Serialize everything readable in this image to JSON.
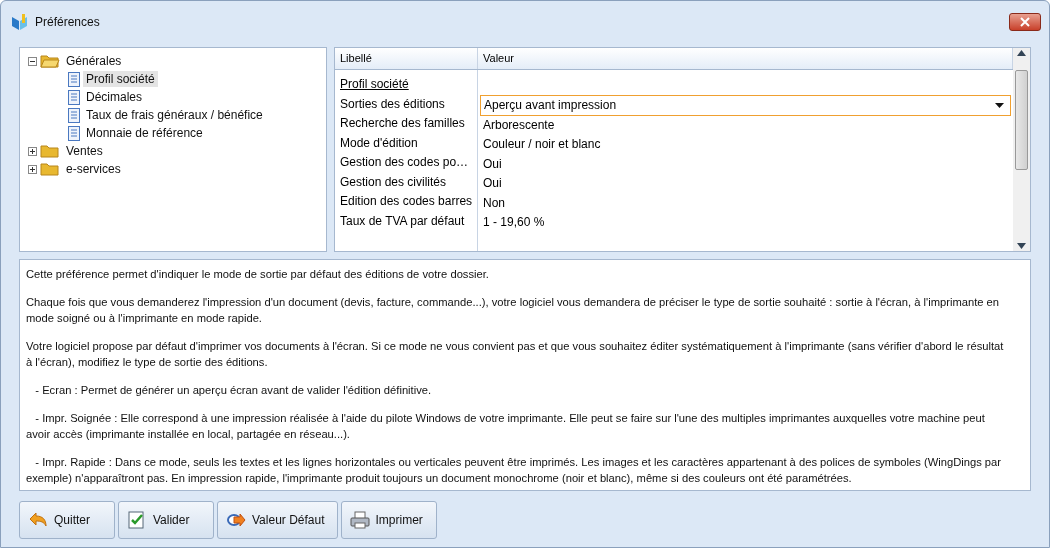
{
  "window": {
    "title": "Préférences"
  },
  "tree": [
    {
      "label": "Générales",
      "expanded": true,
      "selected": false,
      "children": [
        {
          "label": "Profil société",
          "selected": true
        },
        {
          "label": "Décimales",
          "selected": false
        },
        {
          "label": "Taux de frais généraux / bénéfice",
          "selected": false
        },
        {
          "label": "Monnaie de référence",
          "selected": false
        }
      ]
    },
    {
      "label": "Ventes",
      "expanded": false,
      "selected": false
    },
    {
      "label": "e-services",
      "expanded": false,
      "selected": false
    }
  ],
  "grid": {
    "columns": [
      "Libellé",
      "Valeur"
    ],
    "rows": [
      {
        "kind": "section",
        "label": "Profil société"
      },
      {
        "kind": "combo",
        "label": "Sorties des éditions",
        "value": "Aperçu avant impression"
      },
      {
        "kind": "text",
        "label": "Recherche des familles",
        "value": "Arborescente"
      },
      {
        "kind": "text",
        "label": "Mode d'édition",
        "value": "Couleur / noir et blanc"
      },
      {
        "kind": "text",
        "label": "Gestion des codes po…",
        "value": "Oui"
      },
      {
        "kind": "text",
        "label": "Gestion des civilités",
        "value": "Oui"
      },
      {
        "kind": "text",
        "label": "Edition des codes barres",
        "value": "Non"
      },
      {
        "kind": "text",
        "label": "Taux de TVA par défaut",
        "value": "1 - 19,60 %"
      }
    ]
  },
  "description": [
    "Cette préférence permet d'indiquer le mode de sortie par défaut des éditions de votre dossier.",
    "Chaque fois que vous demanderez l'impression d'un document (devis, facture, commande...), votre logiciel vous demandera de préciser le type de sortie souhaité : sortie à l'écran, à l'imprimante en mode soigné ou à l'imprimante en mode rapide.",
    "Votre logiciel propose par défaut d'imprimer vos documents à l'écran. Si ce mode ne vous convient pas et que vous souhaitez éditer systématiquement à l'imprimante (sans vérifier d'abord le résultat à l'écran), modifiez le type de sortie des éditions.",
    "   - Ecran : Permet de générer un aperçu écran avant de valider l'édition définitive.",
    "   - Impr. Soignée : Elle correspond à une impression réalisée à l'aide du pilote Windows de votre imprimante. Elle peut se faire sur l'une des multiples imprimantes auxquelles votre machine peut avoir accès (imprimante installée en local, partagée en réseau...).",
    "   - Impr. Rapide : Dans ce mode, seuls les textes et les lignes horizontales ou verticales peuvent être imprimés. Les images et les caractères appartenant à des polices de symboles (WingDings par exemple) n'apparaîtront pas. En impression rapide, l'imprimante produit toujours un document monochrome (noir et blanc), même si des couleurs ont été paramétrées."
  ],
  "buttons": [
    {
      "kind": "quit",
      "label": "Quitter"
    },
    {
      "kind": "validate",
      "label": "Valider"
    },
    {
      "kind": "default",
      "label": "Valeur Défaut"
    },
    {
      "kind": "print",
      "label": "Imprimer"
    }
  ]
}
